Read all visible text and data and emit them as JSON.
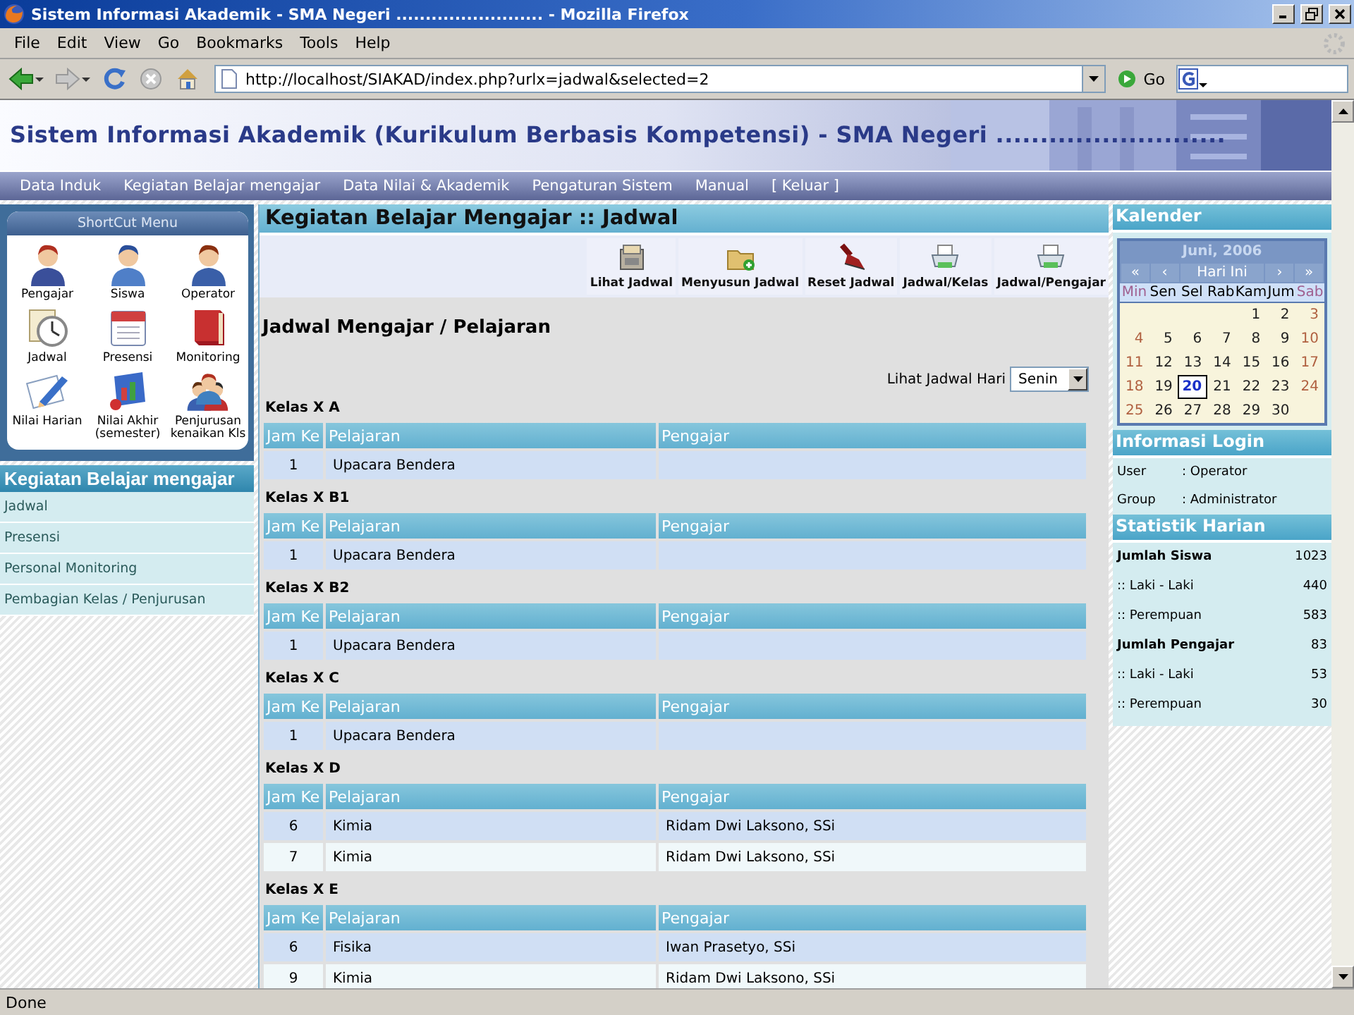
{
  "window": {
    "title": "Sistem Informasi Akademik - SMA Negeri ......................... - Mozilla Firefox"
  },
  "menu_bar": [
    "File",
    "Edit",
    "View",
    "Go",
    "Bookmarks",
    "Tools",
    "Help"
  ],
  "toolbar": {
    "url": "http://localhost/SIAKAD/index.php?urlx=jadwal&selected=2",
    "go_label": "Go"
  },
  "site": {
    "title": "Sistem Informasi Akademik (Kurikulum Berbasis Kompetensi) - SMA Negeri ..........................",
    "nav": [
      "Data Induk",
      "Kegiatan Belajar mengajar",
      "Data Nilai & Akademik",
      "Pengaturan Sistem",
      "Manual",
      "[ Keluar ]"
    ]
  },
  "shortcut_menu": {
    "title": "ShortCut Menu",
    "items": [
      {
        "label": "Pengajar"
      },
      {
        "label": "Siswa"
      },
      {
        "label": "Operator"
      },
      {
        "label": "Jadwal"
      },
      {
        "label": "Presensi"
      },
      {
        "label": "Monitoring"
      },
      {
        "label": "Nilai Harian"
      },
      {
        "label": "Nilai Akhir (semester)"
      },
      {
        "label": "Penjurusan kenaikan Kls"
      }
    ]
  },
  "sidebar": {
    "title": "Kegiatan Belajar mengajar",
    "items": [
      "Jadwal",
      "Presensi",
      "Personal Monitoring",
      "Pembagian Kelas / Penjurusan"
    ]
  },
  "main": {
    "title": "Kegiatan Belajar Mengajar :: Jadwal",
    "actions": [
      "Lihat Jadwal",
      "Menyusun Jadwal",
      "Reset Jadwal",
      "Jadwal/Kelas",
      "Jadwal/Pengajar"
    ],
    "heading": "Jadwal Mengajar / Pelajaran",
    "day_select": {
      "label": "Lihat Jadwal Hari",
      "value": "Senin"
    },
    "classes": [
      {
        "name": "Kelas X A",
        "columns": [
          "Jam Ke",
          "Pelajaran",
          "Pengajar"
        ],
        "rows": [
          {
            "jam": "1",
            "pelajaran": "Upacara Bendera"
          }
        ]
      },
      {
        "name": "Kelas X B1",
        "columns": [
          "Jam Ke",
          "Pelajaran",
          "Pengajar"
        ],
        "rows": [
          {
            "jam": "1",
            "pelajaran": "Upacara Bendera"
          }
        ]
      },
      {
        "name": "Kelas X B2",
        "columns": [
          "Jam Ke",
          "Pelajaran",
          "Pengajar"
        ],
        "rows": [
          {
            "jam": "1",
            "pelajaran": "Upacara Bendera"
          }
        ]
      },
      {
        "name": "Kelas X C",
        "columns": [
          "Jam Ke",
          "Pelajaran",
          "Pengajar"
        ],
        "rows": [
          {
            "jam": "1",
            "pelajaran": "Upacara Bendera"
          }
        ]
      },
      {
        "name": "Kelas X D",
        "columns": [
          "Jam Ke",
          "Pelajaran",
          "Pengajar"
        ],
        "rows": [
          {
            "jam": "6",
            "pelajaran": "Kimia",
            "pengajar": "Ridam Dwi Laksono, SSi"
          },
          {
            "jam": "7",
            "pelajaran": "Kimia",
            "pengajar": "Ridam Dwi Laksono, SSi"
          }
        ]
      },
      {
        "name": "Kelas X E",
        "columns": [
          "Jam Ke",
          "Pelajaran",
          "Pengajar"
        ],
        "rows": [
          {
            "jam": "6",
            "pelajaran": "Fisika",
            "pengajar": "Iwan Prasetyo, SSi"
          },
          {
            "jam": "9",
            "pelajaran": "Kimia",
            "pengajar": "Ridam Dwi Laksono, SSi"
          }
        ]
      }
    ]
  },
  "calendar": {
    "title": "Kalender",
    "month": "Juni, 2006",
    "nav": [
      "«",
      "‹",
      "Hari Ini",
      "›",
      "»"
    ],
    "weekdays": [
      "Min",
      "Sen",
      "Sel",
      "Rab",
      "Kam",
      "Jum",
      "Sab"
    ],
    "weeks": [
      [
        {
          "d": "1",
          "selected": false
        },
        {
          "d": "2",
          "selected": false
        },
        {
          "d": "3",
          "selected": false
        }
      ],
      [
        {
          "d": "4",
          "selected": false
        },
        {
          "d": "5",
          "selected": false
        },
        {
          "d": "6",
          "selected": false
        },
        {
          "d": "7",
          "selected": false
        },
        {
          "d": "8",
          "selected": false
        },
        {
          "d": "9",
          "selected": false
        },
        {
          "d": "10",
          "selected": false
        }
      ],
      [
        {
          "d": "11",
          "selected": false
        },
        {
          "d": "12",
          "selected": false
        },
        {
          "d": "13",
          "selected": false
        },
        {
          "d": "14",
          "selected": false
        },
        {
          "d": "15",
          "selected": false
        },
        {
          "d": "16",
          "selected": false
        },
        {
          "d": "17",
          "selected": false
        }
      ],
      [
        {
          "d": "18",
          "selected": false
        },
        {
          "d": "19",
          "selected": false
        },
        {
          "d": "20",
          "selected": true
        },
        {
          "d": "21",
          "selected": false
        },
        {
          "d": "22",
          "selected": false
        },
        {
          "d": "23",
          "selected": false
        },
        {
          "d": "24",
          "selected": false
        }
      ],
      [
        {
          "d": "25",
          "selected": false
        },
        {
          "d": "26",
          "selected": false
        },
        {
          "d": "27",
          "selected": false
        },
        {
          "d": "28",
          "selected": false
        },
        {
          "d": "29",
          "selected": false
        },
        {
          "d": "30",
          "selected": false
        }
      ]
    ]
  },
  "login_info": {
    "title": "Informasi Login",
    "rows": [
      {
        "label": "User",
        "value": ": Operator"
      },
      {
        "label": "Group",
        "value": ": Administrator"
      }
    ]
  },
  "stats": {
    "title": "Statistik Harian",
    "rows": [
      {
        "kind": "total",
        "label": "Jumlah Siswa",
        "value": "1023"
      },
      {
        "kind": "sub",
        "label": ":: Laki - Laki",
        "value": "440"
      },
      {
        "kind": "sub",
        "label": ":: Perempuan",
        "value": "583"
      },
      {
        "kind": "total",
        "label": "Jumlah Pengajar",
        "value": "83"
      },
      {
        "kind": "sub",
        "label": ":: Laki - Laki",
        "value": "53"
      },
      {
        "kind": "sub",
        "label": ":: Perempuan",
        "value": "30"
      }
    ]
  },
  "status_bar": "Done"
}
